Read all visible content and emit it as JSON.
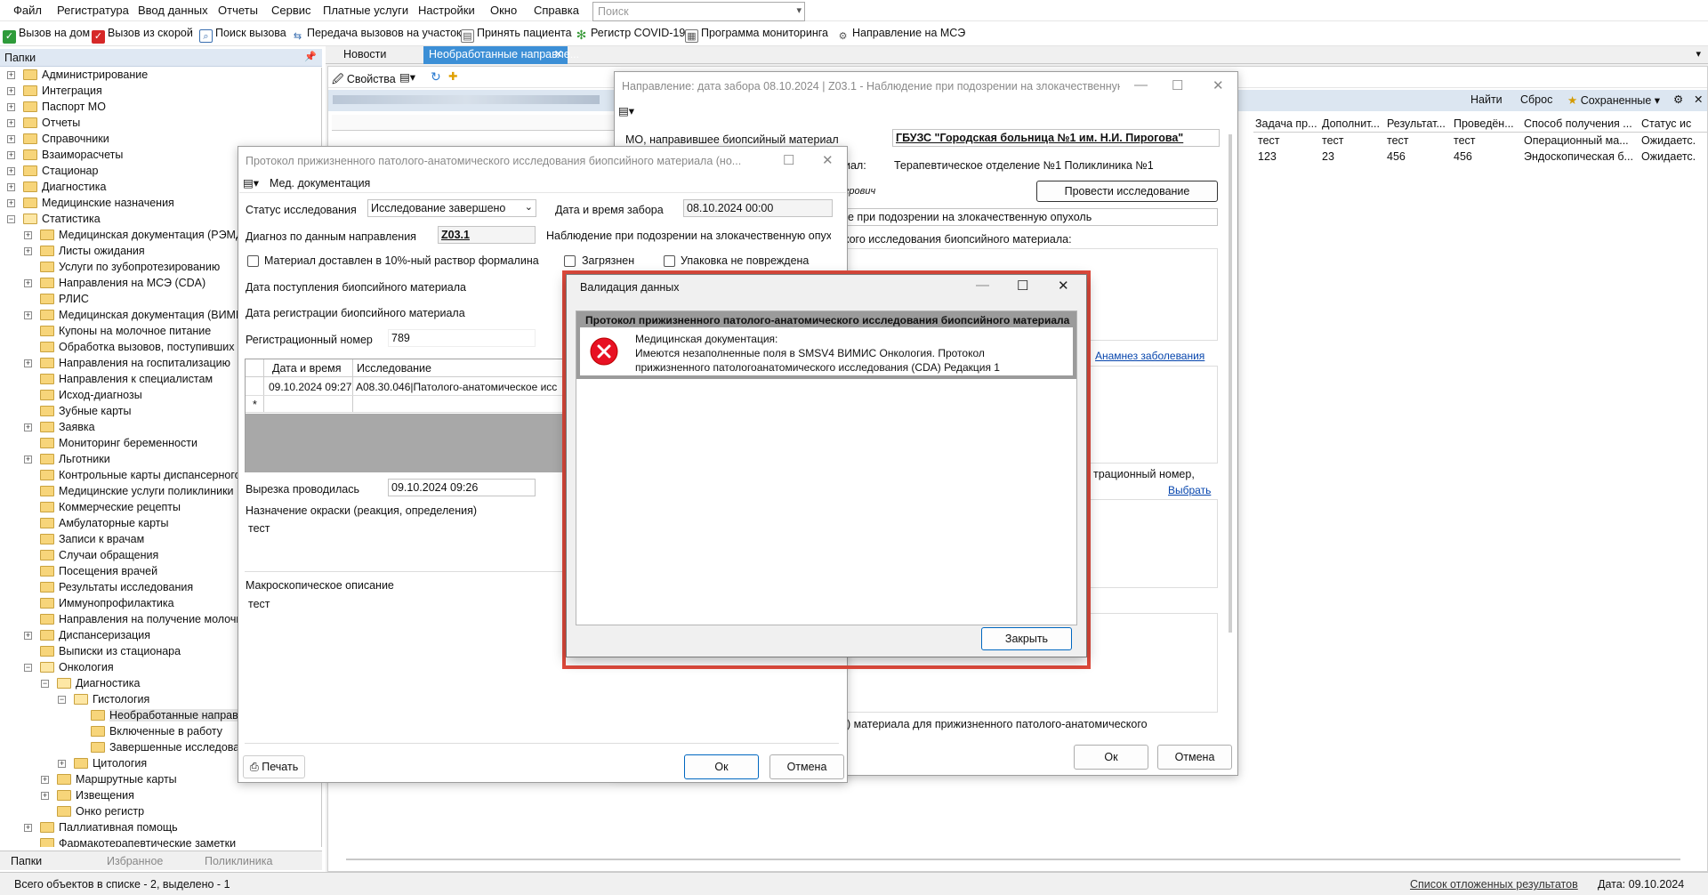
{
  "menu": [
    "Файл",
    "Регистратура",
    "Ввод данных",
    "Отчеты",
    "Сервис",
    "Платные услуги",
    "Настройки",
    "Окно",
    "Справка"
  ],
  "search_placeholder": "Поиск",
  "quickbar": [
    {
      "label": "Вызов на дом",
      "icon": "home-call-icon",
      "color": "#2e9b3a"
    },
    {
      "label": "Вызов из скорой",
      "icon": "ambulance-icon",
      "color": "#d62828"
    },
    {
      "label": "Поиск вызова",
      "icon": "search-call-icon",
      "color": "#3a6fb0"
    },
    {
      "label": "Передача вызовов на участок",
      "icon": "transfer-icon",
      "color": "#3a6fb0"
    },
    {
      "label": "Принять пациента",
      "icon": "patient-icon",
      "color": "#3a6fb0"
    },
    {
      "label": "Регистр COVID-19",
      "icon": "covid-icon",
      "color": "#3a9b3a"
    },
    {
      "label": "Программа мониторинга",
      "icon": "monitor-icon",
      "color": "#555555"
    },
    {
      "label": "Направление на МСЭ",
      "icon": "mse-icon",
      "color": "#555555"
    }
  ],
  "folders_title": "Папки",
  "tree": [
    {
      "label": "Администрирование",
      "lvl": 0,
      "exp": "+"
    },
    {
      "label": "Интеграция",
      "lvl": 0,
      "exp": "+"
    },
    {
      "label": "Паспорт МО",
      "lvl": 0,
      "exp": "+"
    },
    {
      "label": "Отчеты",
      "lvl": 0,
      "exp": "+"
    },
    {
      "label": "Справочники",
      "lvl": 0,
      "exp": "+"
    },
    {
      "label": "Взаиморасчеты",
      "lvl": 0,
      "exp": "+"
    },
    {
      "label": "Стационар",
      "lvl": 0,
      "exp": "+"
    },
    {
      "label": "Диагностика",
      "lvl": 0,
      "exp": "+"
    },
    {
      "label": "Медицинские назначения",
      "lvl": 0,
      "exp": "+"
    },
    {
      "label": "Статистика",
      "lvl": 0,
      "exp": "-"
    },
    {
      "label": "Медицинская документация (РЭМД)",
      "lvl": 1,
      "exp": "+"
    },
    {
      "label": "Листы ожидания",
      "lvl": 1,
      "exp": "+"
    },
    {
      "label": "Услуги по зубопротезированию",
      "lvl": 1,
      "exp": ""
    },
    {
      "label": "Направления на МСЭ (CDA)",
      "lvl": 1,
      "exp": "+"
    },
    {
      "label": "РЛИС",
      "lvl": 1,
      "exp": ""
    },
    {
      "label": "Медицинская документация (ВИМИС)",
      "lvl": 1,
      "exp": "+"
    },
    {
      "label": "Купоны на молочное питание",
      "lvl": 1,
      "exp": ""
    },
    {
      "label": "Обработка вызовов, поступивших из",
      "lvl": 1,
      "exp": ""
    },
    {
      "label": "Направления на госпитализацию",
      "lvl": 1,
      "exp": "+"
    },
    {
      "label": "Направления к специалистам",
      "lvl": 1,
      "exp": ""
    },
    {
      "label": "Исход-диагнозы",
      "lvl": 1,
      "exp": ""
    },
    {
      "label": "Зубные карты",
      "lvl": 1,
      "exp": ""
    },
    {
      "label": "Заявка",
      "lvl": 1,
      "exp": "+"
    },
    {
      "label": "Мониторинг беременности",
      "lvl": 1,
      "exp": ""
    },
    {
      "label": "Льготники",
      "lvl": 1,
      "exp": "+"
    },
    {
      "label": "Контрольные карты диспансерного н",
      "lvl": 1,
      "exp": ""
    },
    {
      "label": "Медицинские услуги поликлиники",
      "lvl": 1,
      "exp": ""
    },
    {
      "label": "Коммерческие рецепты",
      "lvl": 1,
      "exp": ""
    },
    {
      "label": "Амбулаторные карты",
      "lvl": 1,
      "exp": ""
    },
    {
      "label": "Записи к врачам",
      "lvl": 1,
      "exp": ""
    },
    {
      "label": "Случаи обращения",
      "lvl": 1,
      "exp": ""
    },
    {
      "label": "Посещения врачей",
      "lvl": 1,
      "exp": ""
    },
    {
      "label": "Результаты исследования",
      "lvl": 1,
      "exp": ""
    },
    {
      "label": "Иммунопрофилактика",
      "lvl": 1,
      "exp": ""
    },
    {
      "label": "Направления на получение молочно",
      "lvl": 1,
      "exp": ""
    },
    {
      "label": "Диспансеризация",
      "lvl": 1,
      "exp": "+"
    },
    {
      "label": "Выписки из стационара",
      "lvl": 1,
      "exp": ""
    },
    {
      "label": "Онкология",
      "lvl": 1,
      "exp": "-"
    },
    {
      "label": "Диагностика",
      "lvl": 2,
      "exp": "-"
    },
    {
      "label": "Гистология",
      "lvl": 3,
      "exp": "-"
    },
    {
      "label": "Необработанные направле",
      "lvl": 4,
      "exp": "",
      "sel": true
    },
    {
      "label": "Включенные в работу",
      "lvl": 4,
      "exp": ""
    },
    {
      "label": "Завершенные исследован",
      "lvl": 4,
      "exp": ""
    },
    {
      "label": "Цитология",
      "lvl": 3,
      "exp": "+"
    },
    {
      "label": "Маршрутные карты",
      "lvl": 2,
      "exp": "+"
    },
    {
      "label": "Извещения",
      "lvl": 2,
      "exp": "+"
    },
    {
      "label": "Онко регистр",
      "lvl": 2,
      "exp": ""
    },
    {
      "label": "Паллиативная помощь",
      "lvl": 1,
      "exp": "+"
    },
    {
      "label": "Фармакотерапевтические заметки",
      "lvl": 1,
      "exp": ""
    }
  ],
  "tree_tabs": [
    "Папки",
    "Избранное",
    "Поликлиника"
  ],
  "status": {
    "left": "Всего объектов в списке - 2, выделено - 1",
    "link": "Список отложенных результатов",
    "date": "Дата: 09.10.2024"
  },
  "doc_tabs": [
    "Новости",
    "Необработанные направле..."
  ],
  "list_toolbar": {
    "props": "Свойства",
    "find": "Найти",
    "reset": "Сброс",
    "saved": "Сохраненные"
  },
  "list_columns": [
    "Задача пр...",
    "Дополнит...",
    "Результат...",
    "Проведён...",
    "Способ получения ...",
    "Статус ис"
  ],
  "list_rows": [
    [
      "тест",
      "тест",
      "тест",
      "тест",
      "Операционный ма...",
      "Ожидаетс."
    ],
    [
      "123",
      "23",
      "456",
      "456",
      "Эндоскопическая б...",
      "Ожидаетс."
    ]
  ],
  "direction_window": {
    "title": "Направление: дата забора 08.10.2024 | Z03.1 - Наблюдение при подозрении на злокачественную о...",
    "mo_label": "МО, направившее биопсийный материал",
    "mo_value": "ГБУЗС \"Городская больница №1 им. Н.И. Пирогова\"",
    "dept_label": "иал:",
    "dept_value": "Терапевтическое отделение №1 Поликлиника №1",
    "doctor_frag": "грович",
    "do_research": "Провести исследование",
    "diag_frag": "е при подозрении на злокачественную опухоль",
    "material_label": "кого исследования биопсийного материала:",
    "anamnesis": "Анамнез заболевания",
    "regnum_frag": "трационный номер,",
    "choose": "Выбрать",
    "bottom_frag": "о) материала для прижизненного патолого-анатомического",
    "ok": "Ок",
    "cancel": "Отмена"
  },
  "protocol_window": {
    "title": "Протокол прижизненного патолого-анатомического исследования биопсийного материала (но...",
    "toolbar_label": "Мед. документация",
    "status_label": "Статус исследования",
    "status_value": "Исследование завершено",
    "date_label": "Дата и время забора",
    "date_value": "08.10.2024 00:00",
    "diag_label": "Диагноз по данным направления",
    "diag_value": "Z03.1",
    "diag_desc": "Наблюдение при подозрении на злокачественную опухо.",
    "formalin": "Материал доставлен в 10%-ный раствор формалина",
    "dirty": "Загрязнен",
    "pack": "Упаковка не повреждена",
    "received": "Дата поступления биопсийного материала",
    "registered": "Дата регистрации биопсийного материала",
    "regnum_label": "Регистрационный номер",
    "regnum_value": "789",
    "grid_headers": [
      "Дата и время",
      "Исследование"
    ],
    "grid_row": [
      "09.10.2024 09:27",
      "A08.30.046|Патолого-анатомическое исс"
    ],
    "grid_new": "*",
    "cut_label": "Вырезка проводилась",
    "cut_value": "09.10.2024 09:26",
    "stain_label": "Назначение окраски (реакция, определения)",
    "stain_value": "тест",
    "macro_label": "Макроскопическое описание",
    "macro_value": "тест",
    "print": "Печать",
    "ok": "Ок",
    "cancel": "Отмена"
  },
  "validation": {
    "title": "Валидация данных",
    "header": "Протокол прижизненного патолого-анатомического исследования биопсийного материала",
    "msg1": "Медицинская документация:",
    "msg2": "Имеются незаполненные поля в SMSV4 ВИМИС Онкология. Протокол",
    "msg3": "прижизненного патологоанатомического исследования (CDA) Редакция 1",
    "close": "Закрыть"
  },
  "colors": {
    "accent": "#0067c0",
    "tab_active": "#3c8fd6",
    "error": "#e04a3c"
  }
}
